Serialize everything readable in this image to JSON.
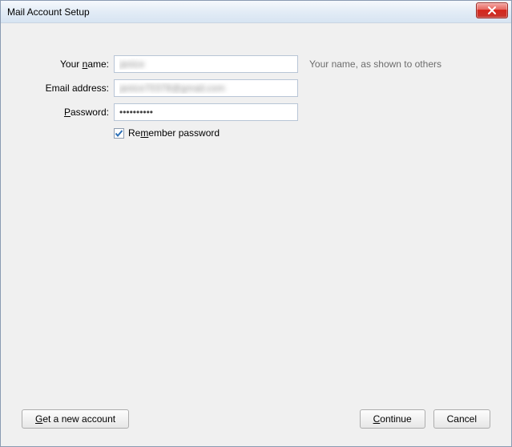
{
  "window": {
    "title": "Mail Account Setup"
  },
  "form": {
    "name_label_pre": "Your ",
    "name_label_ak": "n",
    "name_label_post": "ame:",
    "name_value": "janice",
    "name_hint": "Your name, as shown to others",
    "email_label": "Email address:",
    "email_value": "janice70378@gmail.com",
    "password_label_ak": "P",
    "password_label_post": "assword:",
    "password_value": "••••••••••",
    "remember_pre": "Re",
    "remember_ak": "m",
    "remember_post": "ember password",
    "remember_checked": true
  },
  "buttons": {
    "new_account_ak": "G",
    "new_account_post": "et a new account",
    "continue_ak": "C",
    "continue_post": "ontinue",
    "cancel": "Cancel"
  }
}
